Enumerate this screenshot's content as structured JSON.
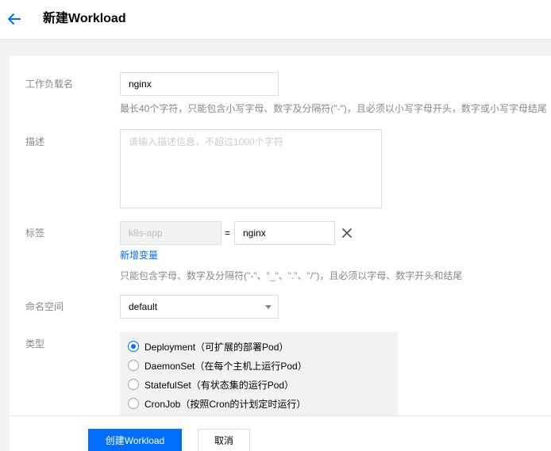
{
  "header": {
    "back_icon": "arrow-left-icon",
    "title": "新建Workload"
  },
  "form": {
    "name": {
      "label": "工作负载名",
      "value": "nginx",
      "hint": "最长40个字符，只能包含小写字母、数字及分隔符(\"-\")，且必须以小写字母开头，数字或小写字母结尾"
    },
    "description": {
      "label": "描述",
      "placeholder": "请输入描述信息，不超过1000个字符"
    },
    "labels": {
      "label": "标签",
      "key_value": "k8s-app",
      "equals": "=",
      "value_value": "nginx",
      "remove_icon": "close-icon",
      "add_link": "新增变量",
      "hint": "只能包含字母、数字及分隔符(\"-\"、\"_\"、\".\"、\"/\")，且必须以字母、数字开头和结尾"
    },
    "namespace": {
      "label": "命名空间",
      "selected": "default"
    },
    "type": {
      "label": "类型",
      "options": [
        {
          "label": "Deployment（可扩展的部署Pod）",
          "checked": true
        },
        {
          "label": "DaemonSet（在每个主机上运行Pod）",
          "checked": false
        },
        {
          "label": "StatefulSet（有状态集的运行Pod）",
          "checked": false
        },
        {
          "label": "CronJob（按照Cron的计划定时运行）",
          "checked": false
        }
      ]
    }
  },
  "footer": {
    "create_label": "创建Workload",
    "cancel_label": "取消"
  },
  "colors": {
    "primary": "#006eff",
    "label_gray": "#888888",
    "background": "#f2f2f2"
  }
}
